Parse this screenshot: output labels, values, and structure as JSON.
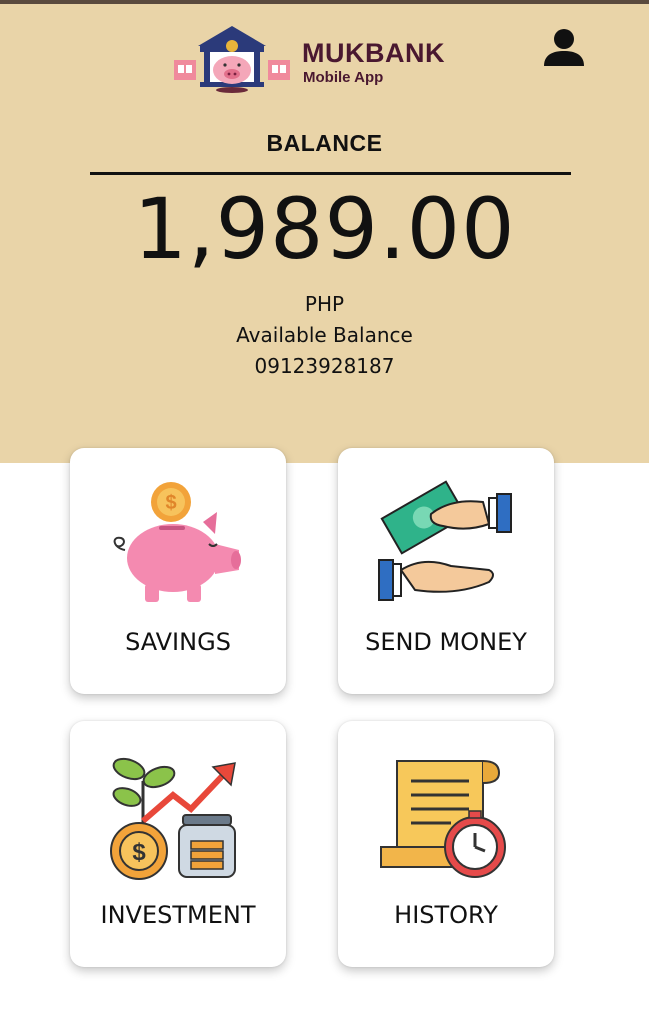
{
  "header": {
    "brand_name": "MUKBANK",
    "brand_sub": "Mobile App",
    "profile_icon": "user-icon"
  },
  "balance": {
    "label": "BALANCE",
    "amount": "1,989.00",
    "currency": "PHP",
    "caption": "Available Balance",
    "account_number": "09123928187"
  },
  "menu": [
    {
      "label": "SAVINGS",
      "icon": "piggy-bank-icon"
    },
    {
      "label": "SEND MONEY",
      "icon": "money-transfer-icon"
    },
    {
      "label": "INVESTMENT",
      "icon": "investment-growth-icon"
    },
    {
      "label": "HISTORY",
      "icon": "history-receipt-icon"
    }
  ],
  "colors": {
    "header_bg": "#e9d4a8",
    "brand": "#4a1830",
    "card_bg": "#ffffff",
    "top_bar": "#5a4a3e"
  }
}
